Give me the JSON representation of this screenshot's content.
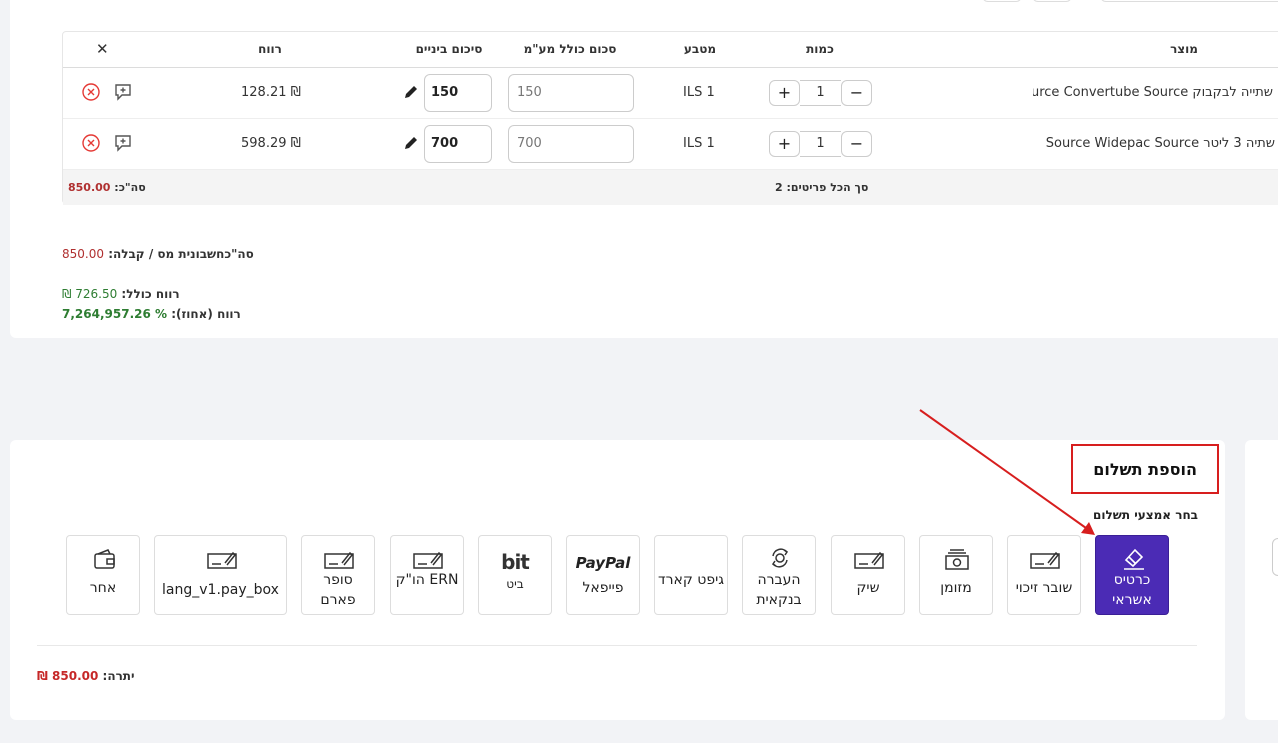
{
  "table": {
    "headers": {
      "product": "מוצר",
      "quantity": "כמות",
      "currency": "מטבע",
      "total_incl_vat": "סכום כולל מע\"מ",
      "cost_total": "סיכום ביניים",
      "profit": "רווח"
    },
    "rows": [
      {
        "product": "שתייה לבקבוק Source Convertube Source",
        "qty": "1",
        "currency": "ILS 1",
        "total_incl_vat": "150",
        "cost": "150",
        "profit": "128.21 ₪"
      },
      {
        "product": "שתיה 3 ליטר Source Widepac Source",
        "qty": "1",
        "currency": "ILS 1",
        "total_incl_vat": "700",
        "cost": "700",
        "profit": "598.29 ₪"
      }
    ],
    "footer": {
      "items_label": "סך הכל פריטים:",
      "items_count": "2",
      "total_label": "סה\"כ:",
      "total_value": "850.00"
    },
    "plus": "+",
    "minus": "−",
    "close": "✕"
  },
  "summary": {
    "invoice_label": "סה\"כחשבונית מס / קבלה:",
    "invoice_value": "850.00",
    "profit_label": "רווח כולל:",
    "profit_value": "726.50 ₪",
    "profit_pct_label": "רווח (אחוז):",
    "profit_pct_value": "% 7,264,957.26"
  },
  "payment": {
    "title": "הוספת תשלום",
    "subtitle": "בחר אמצעי תשלום",
    "methods": [
      {
        "label": "כרטיס אשראי",
        "icon": "credit-card-icon"
      },
      {
        "label": "שובר זיכוי",
        "icon": "voucher-icon"
      },
      {
        "label": "מזומן",
        "icon": "cash-icon"
      },
      {
        "label": "שיק",
        "icon": "check-icon"
      },
      {
        "label": "העברה בנקאית",
        "icon": "bank-transfer-icon"
      },
      {
        "label": "גיפט קארד",
        "icon": ""
      },
      {
        "label": "פייפאל",
        "icon": "paypal-icon",
        "logo": "PayPal"
      },
      {
        "label": "ביט",
        "icon": "bit-icon",
        "logo": "bit"
      },
      {
        "label": "הו\"ק ERN",
        "icon": "standing-order-icon"
      },
      {
        "label": "סופר פארם",
        "icon": "super-pharm-icon"
      },
      {
        "label": "lang_v1.pay_box",
        "icon": "paybox-icon"
      },
      {
        "label": "אחר",
        "icon": "wallet-icon"
      }
    ],
    "balance_label": "יתרה:",
    "balance_value": "850.00 ₪"
  },
  "colors": {
    "accent": "#4b2bb5",
    "highlight_box": "#d71e1e",
    "negative": "#b03030",
    "positive": "#2e7d32"
  }
}
